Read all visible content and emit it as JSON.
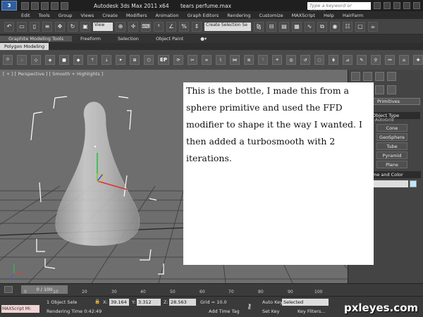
{
  "title_bar": {
    "app_name": "Autodesk 3ds Max  2011 x64",
    "file_name": "tears perfume.max",
    "search_placeholder": "Type a keyword or phrase"
  },
  "menu": [
    "Edit",
    "Tools",
    "Group",
    "Views",
    "Create",
    "Modifiers",
    "Animation",
    "Graph Editors",
    "Rendering",
    "Customize",
    "MAXScript",
    "Help",
    "HairFarm"
  ],
  "toolbar": {
    "view_dropdown": "View",
    "selection_set": "Create Selection Se"
  },
  "ribbon": {
    "tabs": [
      "Graphite Modeling Tools",
      "Freeform",
      "Selection",
      "Object Paint"
    ],
    "active_tab": "Graphite Modeling Tools",
    "sub_label": "Polygon Modeling",
    "ep_label": "EP"
  },
  "viewport": {
    "label": "[ + ] [ Perspective ] [ Smooth + Highlights ]"
  },
  "right_panel": {
    "category_dropdown": "Primitives",
    "autogrid": "AutoGrid",
    "object_type_header": "Object Type",
    "buttons": [
      "Cone",
      "GeoSphere",
      "Tube",
      "Pyramid",
      "Plane"
    ],
    "name_color_header": "ame and Color"
  },
  "note": {
    "text": "This is the bottle, I made this from a sphere primitive and used the FFD modifier to shape it the way I wanted. I then added a turbosmooth with 2 iterations."
  },
  "timeline": {
    "frame_indicator": "0 / 100",
    "ticks": [
      "0",
      "10",
      "20",
      "30",
      "40",
      "50",
      "60",
      "70",
      "80",
      "90",
      "100"
    ]
  },
  "status": {
    "maxscript": "MAXScript Mi:",
    "object_sel": "1 Object Sele",
    "render_time": "Rendering Time  0:42:49",
    "x_label": "X:",
    "x_value": "39.164",
    "y_label": "Y:",
    "y_value": "3.312",
    "z_label": "Z:",
    "z_value": "28.563",
    "grid": "Grid = 10.0",
    "add_time_tag": "Add Time Tag",
    "auto_key": "Auto Key",
    "auto_key_value": "Selected",
    "set_key": "Set Key",
    "key_filters": "Key Filters..."
  },
  "watermark": "pxleyes.com"
}
